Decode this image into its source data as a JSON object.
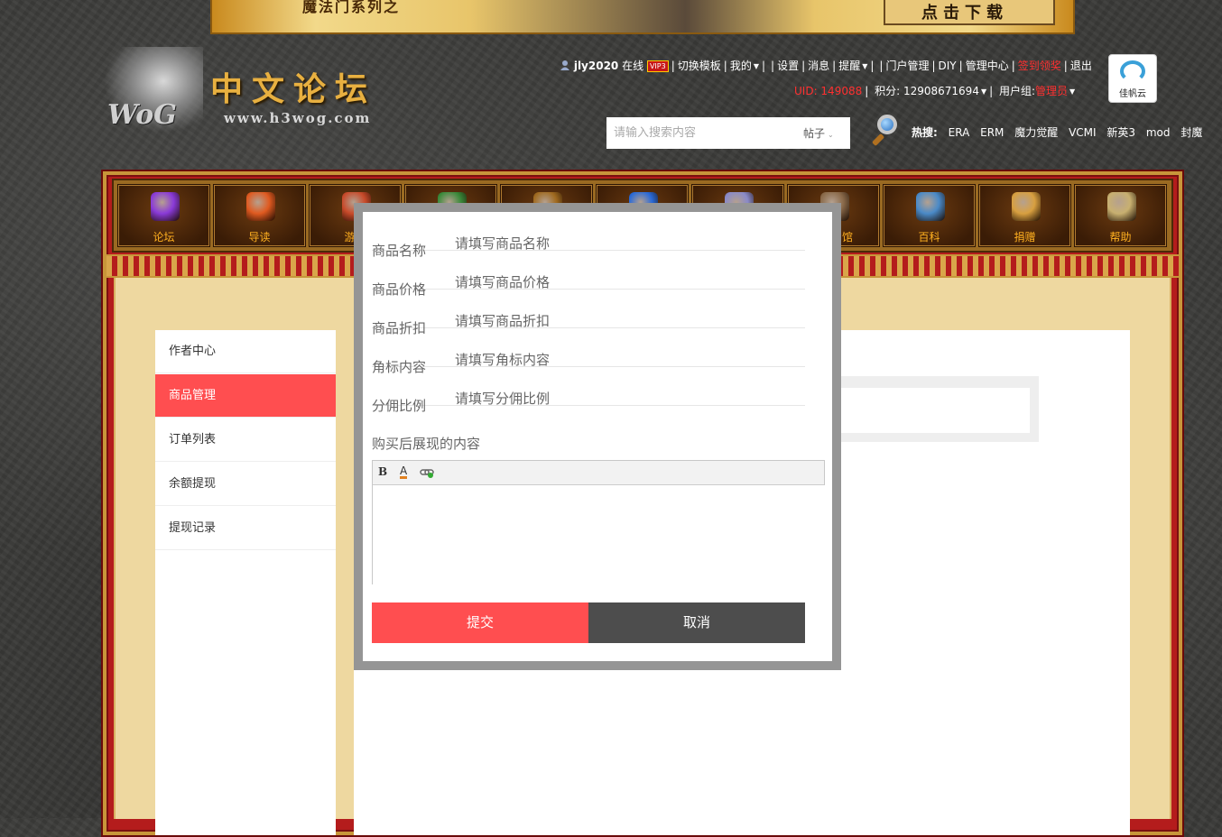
{
  "banner": {
    "left_text": "魔法门系列之",
    "right_text": "点击下载"
  },
  "logo": {
    "wog": "WoG",
    "cn_title": "中文论坛",
    "url": "www.h3wog.com"
  },
  "userbar": {
    "username": "jly2020",
    "online": "在线",
    "vip": "VIP3",
    "links": [
      "切换模板",
      "我的",
      "设置",
      "消息",
      "提醒",
      "门户管理",
      "DIY",
      "管理中心"
    ],
    "sign_in": "签到领奖",
    "logout": "退出",
    "uid": "UID: 149088",
    "points": "积分: 12908671694",
    "group_label": "用户组:",
    "group_value": "管理员"
  },
  "cloud_badge": "佳帆云",
  "search": {
    "placeholder": "请输入搜索内容",
    "type": "帖子",
    "hot_label": "热搜:",
    "hot_tags": [
      "ERA",
      "ERM",
      "魔力觉醒",
      "VCMI",
      "新英3",
      "mod",
      "封魔"
    ]
  },
  "nav": [
    {
      "label": "论坛",
      "color": "#8a3ad8"
    },
    {
      "label": "导读",
      "color": "#e05a20"
    },
    {
      "label": "游戏",
      "color": "#c84a2a"
    },
    {
      "label": "",
      "color": "#3a8a3a"
    },
    {
      "label": "",
      "color": "#a06a20"
    },
    {
      "label": "",
      "color": "#2a6ad8"
    },
    {
      "label": "",
      "color": "#8a8ac8"
    },
    {
      "label": "馆",
      "color": "#8a6a4a"
    },
    {
      "label": "百科",
      "color": "#4a8ac8"
    },
    {
      "label": "捐赠",
      "color": "#d8a040"
    },
    {
      "label": "帮助",
      "color": "#c8b070"
    }
  ],
  "sidebar": [
    {
      "label": "作者中心",
      "active": false
    },
    {
      "label": "商品管理",
      "active": true
    },
    {
      "label": "订单列表",
      "active": false
    },
    {
      "label": "余额提现",
      "active": false
    },
    {
      "label": "提现记录",
      "active": false
    }
  ],
  "modal": {
    "fields": [
      {
        "label": "商品名称",
        "placeholder": "请填写商品名称"
      },
      {
        "label": "商品价格",
        "placeholder": "请填写商品价格"
      },
      {
        "label": "商品折扣",
        "placeholder": "请填写商品折扣"
      },
      {
        "label": "角标内容",
        "placeholder": "请填写角标内容"
      },
      {
        "label": "分佣比例",
        "placeholder": "请填写分佣比例"
      }
    ],
    "after_purchase_label": "购买后展现的内容",
    "editor_toolbar": {
      "bold": "B",
      "font_color": "A"
    },
    "submit": "提交",
    "cancel": "取消"
  }
}
